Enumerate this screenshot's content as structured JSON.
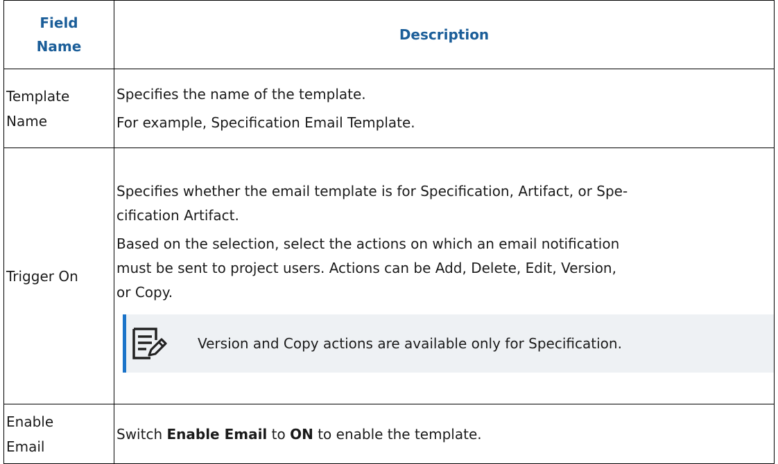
{
  "header": {
    "field_name": "Field\nName",
    "field_name_line1": "Field",
    "field_name_line2": "Name",
    "description": "Description"
  },
  "rows": [
    {
      "field_line1": "Template",
      "field_line2": "Name",
      "paragraphs": [
        "Specifies the name of the template.",
        "For example, Specification Email Template."
      ]
    },
    {
      "field": "Trigger On",
      "paragraphs": [
        "Specifies whether the email template is for Specification, Artifact, or Spe-",
        "cification Artifact.",
        "Based on the selection, select the actions on which an email notification",
        "must be sent to project users. Actions can be Add, Delete, Edit, Version,",
        "or Copy."
      ],
      "note": {
        "icon": "note-edit-icon",
        "text": "Version and Copy actions are available only for Specification."
      }
    },
    {
      "field_line1": "Enable",
      "field_line2": "Email",
      "text_prefix": "Switch ",
      "text_bold1": "Enable Email",
      "text_mid": " to ",
      "text_bold2": "ON",
      "text_suffix": " to enable the template."
    }
  ],
  "colors": {
    "header_text": "#1b5e99",
    "note_background": "#eef1f4",
    "note_accent": "#1b74c9"
  }
}
